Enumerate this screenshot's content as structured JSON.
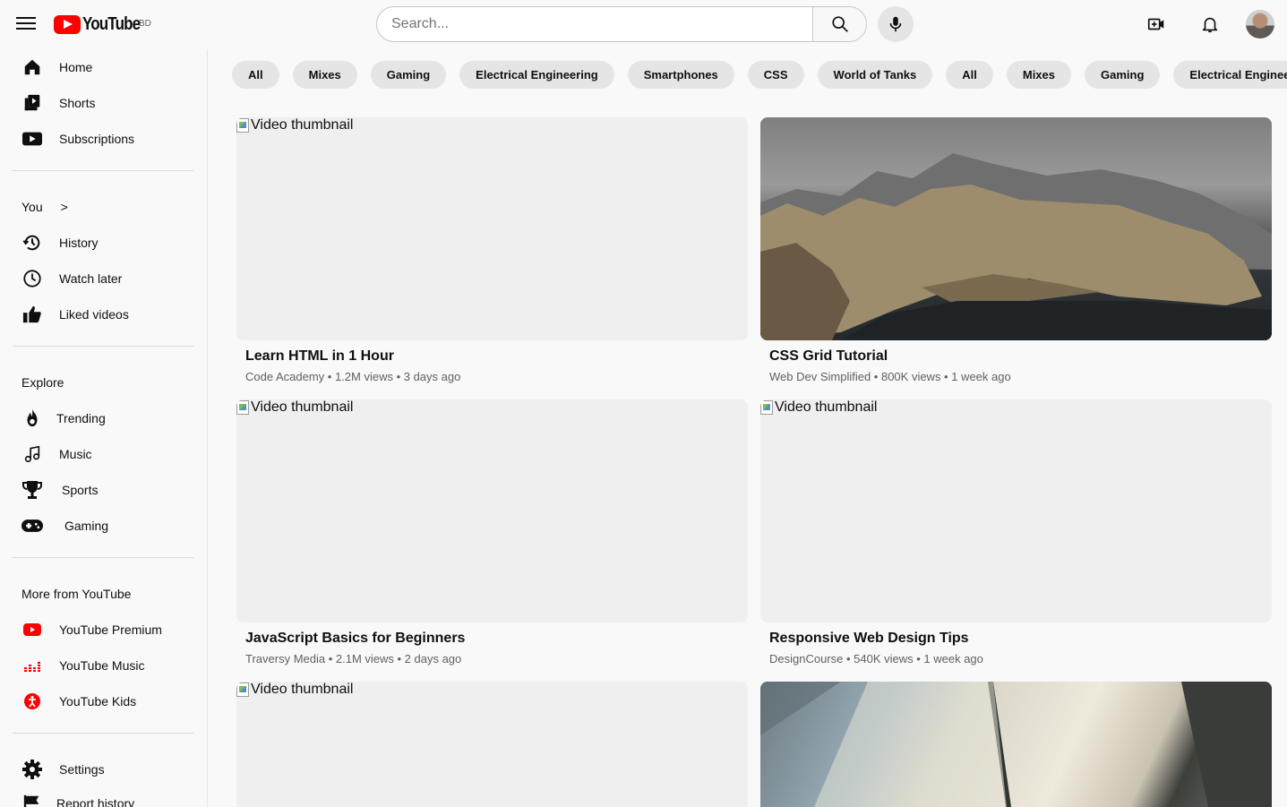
{
  "header": {
    "logo_text": "YouTube",
    "country_code": "BD",
    "search_placeholder": "Search..."
  },
  "sidebar": {
    "main": [
      {
        "label": "Home",
        "icon": "home-icon"
      },
      {
        "label": "Shorts",
        "icon": "shorts-icon"
      },
      {
        "label": "Subscriptions",
        "icon": "subscriptions-icon"
      }
    ],
    "you_heading": "You",
    "you_arrow": ">",
    "you": [
      {
        "label": "History",
        "icon": "history-icon"
      },
      {
        "label": "Watch later",
        "icon": "clock-icon"
      },
      {
        "label": "Liked videos",
        "icon": "thumbs-up-icon"
      }
    ],
    "explore_heading": "Explore",
    "explore": [
      {
        "label": "Trending",
        "icon": "flame-icon"
      },
      {
        "label": "Music",
        "icon": "music-note-icon"
      },
      {
        "label": "Sports",
        "icon": "trophy-icon"
      },
      {
        "label": "Gaming",
        "icon": "gamepad-icon"
      }
    ],
    "more_heading": "More from YouTube",
    "more": [
      {
        "label": "YouTube Premium",
        "icon": "youtube-premium-icon"
      },
      {
        "label": "YouTube Music",
        "icon": "youtube-music-icon"
      },
      {
        "label": "YouTube Kids",
        "icon": "youtube-kids-icon"
      }
    ],
    "bottom": [
      {
        "label": "Settings",
        "icon": "gear-icon"
      },
      {
        "label": "Report history",
        "icon": "flag-icon"
      }
    ]
  },
  "chips": [
    "All",
    "Mixes",
    "Gaming",
    "Electrical Engineering",
    "Smartphones",
    "CSS",
    "World of Tanks",
    "All",
    "Mixes",
    "Gaming",
    "Electrical Engineering"
  ],
  "videos": [
    {
      "title": "Learn HTML in 1 Hour",
      "meta": "Code Academy • 1.2M views • 3 days ago",
      "thumb_alt": "Video thumbnail"
    },
    {
      "title": "CSS Grid Tutorial",
      "meta": "Web Dev Simplified • 800K views • 1 week ago",
      "thumb_alt": "Video thumbnail"
    },
    {
      "title": "JavaScript Basics for Beginners",
      "meta": "Traversy Media • 2.1M views • 2 days ago",
      "thumb_alt": "Video thumbnail"
    },
    {
      "title": "Responsive Web Design Tips",
      "meta": "DesignCourse • 540K views • 1 week ago",
      "thumb_alt": "Video thumbnail"
    },
    {
      "thumb_alt": "Video thumbnail"
    }
  ],
  "colors": {
    "brand_red": "#ff0000",
    "chip_bg": "#e5e5e5",
    "page_bg": "#f9f9f9"
  }
}
